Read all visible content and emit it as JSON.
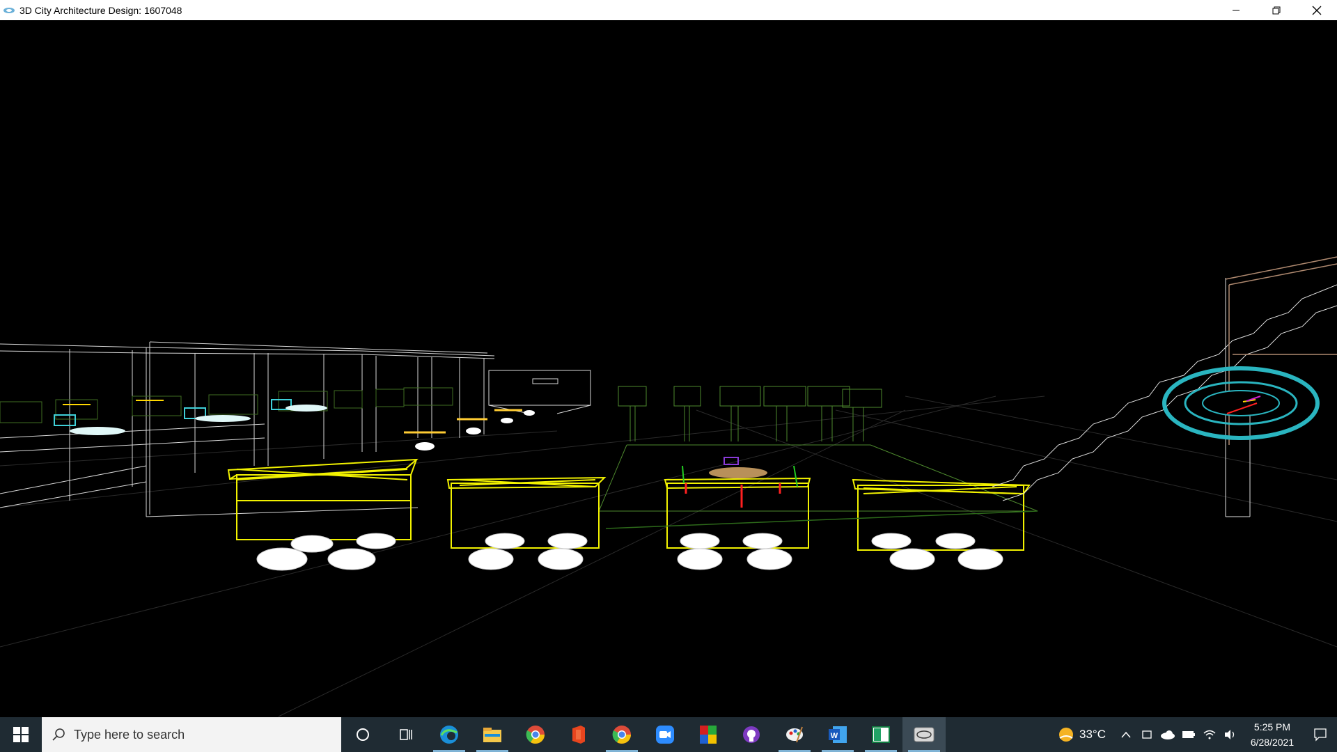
{
  "window": {
    "title": "3D City Architecture Design: 1607048"
  },
  "taskbar": {
    "search_placeholder": "Type here to search",
    "apps": [
      "cortana-icon",
      "task-view-icon",
      "edge-icon",
      "file-explorer-icon",
      "chrome-icon",
      "office-icon",
      "chrome-icon-2",
      "zoom-icon",
      "winrar-icon",
      "github-icon",
      "paint-icon",
      "word-icon",
      "excel-icon",
      "opengl-app-icon"
    ],
    "weather": "33°C",
    "time": "5:25 PM",
    "date": "6/28/2021"
  },
  "colors": {
    "cart": "#f2f200",
    "wire_white": "#e8e8e8",
    "wire_green": "#4a7a2a",
    "torus": "#2ab5c0",
    "taskbar": "#1f2b33"
  }
}
